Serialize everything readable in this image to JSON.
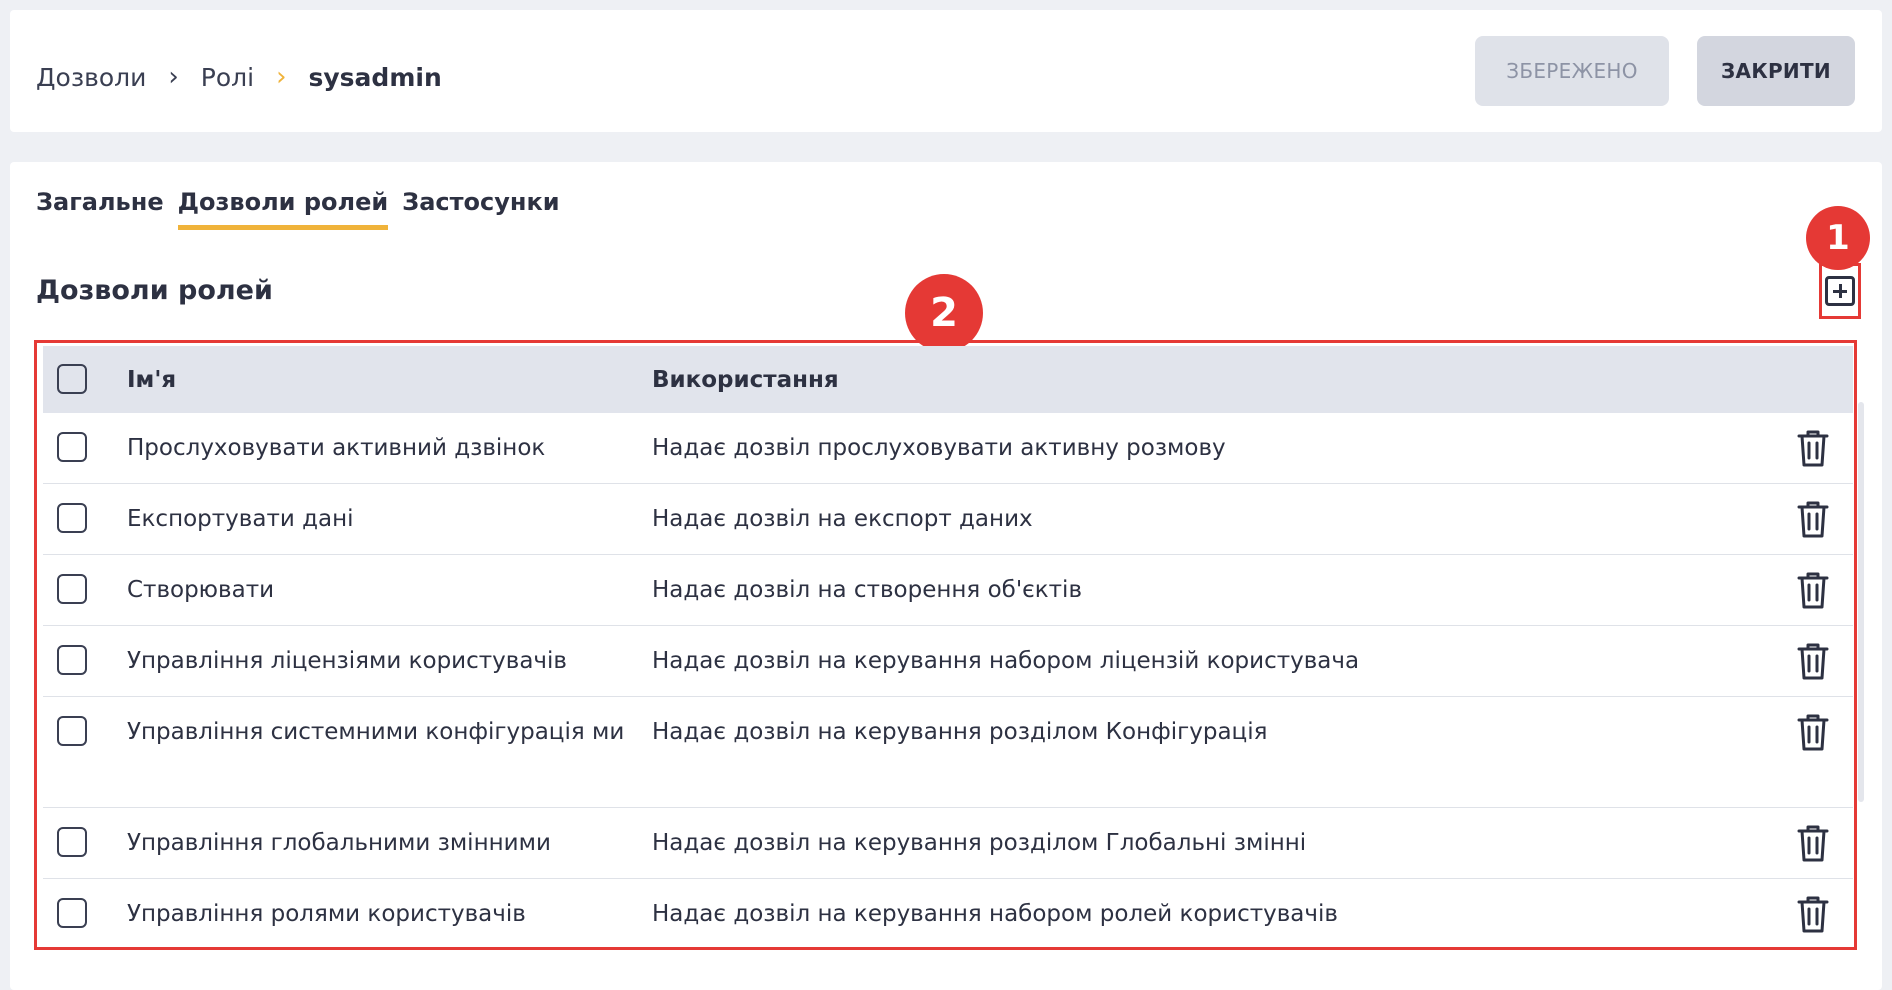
{
  "breadcrumb": {
    "items": [
      "Дозволи",
      "Ролі"
    ],
    "current": "sysadmin",
    "separator": "›"
  },
  "header_buttons": {
    "saved_label": "ЗБЕРЕЖЕНО",
    "close_label": "ЗАКРИТИ"
  },
  "tabs": [
    {
      "label": "Загальне",
      "active": false
    },
    {
      "label": "Дозволи ролей",
      "active": true
    },
    {
      "label": "Застосунки",
      "active": false
    }
  ],
  "section": {
    "title": "Дозволи ролей",
    "add_icon": "plus-square-icon"
  },
  "annotations": {
    "badge_1": "1",
    "badge_2": "2"
  },
  "table": {
    "columns": [
      "Ім'я",
      "Використання"
    ],
    "rows": [
      {
        "name": "Прослуховувати активний дзвінок",
        "usage": "Надає дозвіл прослуховувати активну розмову"
      },
      {
        "name": "Експортувати дані",
        "usage": "Надає дозвіл на експорт даних"
      },
      {
        "name": "Створювати",
        "usage": "Надає дозвіл на створення об'єктів"
      },
      {
        "name": "Управління ліцензіями користувачів",
        "usage": "Надає дозвіл на керування набором ліцензій користувача"
      },
      {
        "name": "Управління системними конфігурація ми",
        "usage": "Надає дозвіл на керування розділом Конфігурація"
      },
      {
        "name": "Управління глобальними змінними",
        "usage": "Надає дозвіл на керування розділом Глобальні змінні"
      },
      {
        "name": "Управління ролями користувачів",
        "usage": "Надає дозвіл на керування набором ролей користувачів"
      }
    ],
    "row_icon": "trash-icon"
  },
  "colors": {
    "accent": "#f0b33a",
    "annotation": "#e53935",
    "header_bg": "#e1e4ec",
    "page_bg": "#eef0f4"
  }
}
